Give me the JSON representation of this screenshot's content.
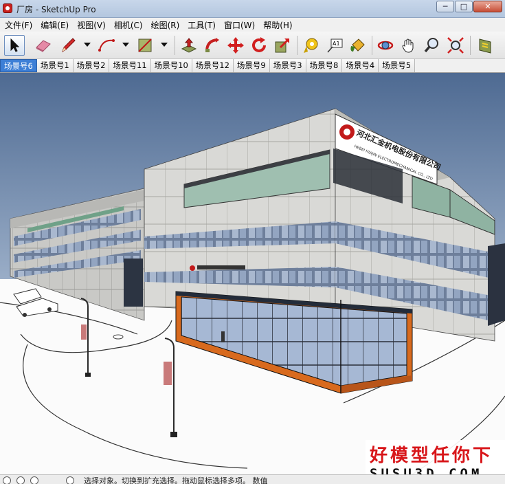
{
  "window": {
    "title": "厂房 - SketchUp Pro",
    "minimize_label": "─",
    "maximize_label": "□",
    "close_label": "✕"
  },
  "menubar": {
    "items": [
      "文件(F)",
      "编辑(E)",
      "视图(V)",
      "相机(C)",
      "绘图(R)",
      "工具(T)",
      "窗口(W)",
      "帮助(H)"
    ]
  },
  "toolbar": {
    "tools": [
      "select-icon",
      "eraser-icon",
      "pencil-icon",
      "arc-icon",
      "rectangle-icon",
      "push-pull-icon",
      "follow-me-icon",
      "move-icon",
      "rotate-icon",
      "scale-icon",
      "tape-measure-icon",
      "text-icon",
      "paint-bucket-icon",
      "orbit-icon",
      "pan-icon",
      "zoom-icon",
      "zoom-extents-icon",
      "section-icon"
    ],
    "active_tool": "select-icon"
  },
  "scene_tabs": {
    "items": [
      "场景号6",
      "场景号1",
      "场景号2",
      "场景号11",
      "场景号10",
      "场景号12",
      "场景号9",
      "场景号3",
      "场景号8",
      "场景号4",
      "场景号5"
    ],
    "active": "场景号6"
  },
  "model": {
    "company_name_cn": "河北汇金机电股份有限公司",
    "company_name_en": "HEBEI HUIJIN ELECTROMECHANICAL CO., LTD",
    "sky_color": "#4b6a93",
    "ground_color": "#ffffff",
    "accent_orange": "#d86a1e"
  },
  "watermark": {
    "line1": "好模型任你下",
    "line2": "SUSU3D.COM"
  },
  "statusbar": {
    "text": "选择对象。切换到扩充选择。拖动鼠标选择多项。  数值"
  }
}
